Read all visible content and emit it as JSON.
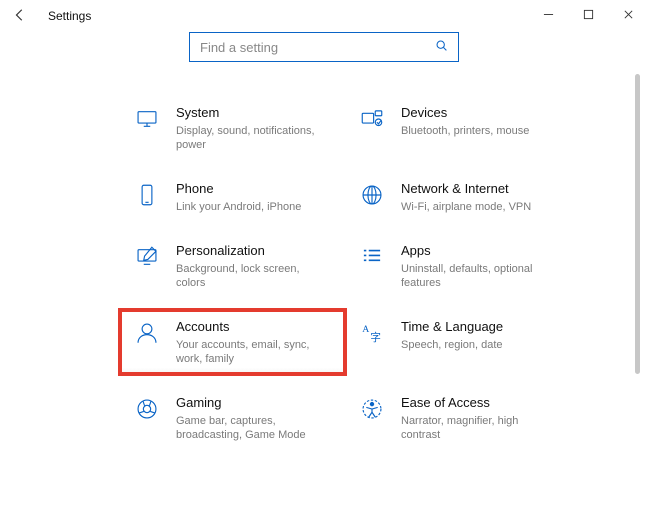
{
  "header": {
    "title": "Settings"
  },
  "search": {
    "placeholder": "Find a setting"
  },
  "tiles": {
    "system": {
      "title": "System",
      "desc": "Display, sound, notifications, power"
    },
    "devices": {
      "title": "Devices",
      "desc": "Bluetooth, printers, mouse"
    },
    "phone": {
      "title": "Phone",
      "desc": "Link your Android, iPhone"
    },
    "network": {
      "title": "Network & Internet",
      "desc": "Wi-Fi, airplane mode, VPN"
    },
    "personal": {
      "title": "Personalization",
      "desc": "Background, lock screen, colors"
    },
    "apps": {
      "title": "Apps",
      "desc": "Uninstall, defaults, optional features"
    },
    "accounts": {
      "title": "Accounts",
      "desc": "Your accounts, email, sync, work, family"
    },
    "time": {
      "title": "Time & Language",
      "desc": "Speech, region, date"
    },
    "gaming": {
      "title": "Gaming",
      "desc": "Game bar, captures, broadcasting, Game Mode"
    },
    "ease": {
      "title": "Ease of Access",
      "desc": "Narrator, magnifier, high contrast"
    }
  },
  "highlight": "accounts",
  "colors": {
    "accent": "#0a64c6",
    "highlight_border": "#e43b2e"
  }
}
